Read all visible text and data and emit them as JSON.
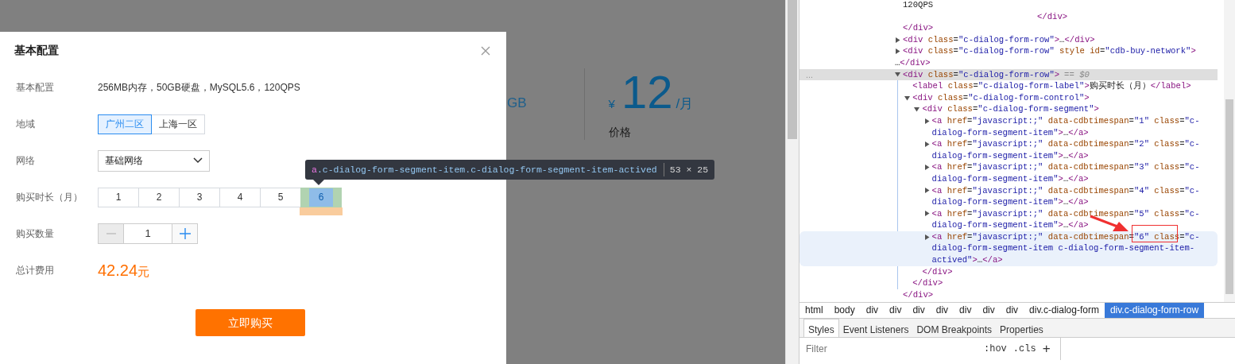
{
  "background_page": {
    "storage_unit": "GB",
    "price": {
      "currency": "¥",
      "amount": "12",
      "per": "/月",
      "label": "价格"
    }
  },
  "dialog": {
    "title": "基本配置",
    "rows": [
      {
        "kind": "text",
        "label": "基本配置",
        "value": "256MB内存，50GB硬盘，MySQL5.6，120QPS"
      },
      {
        "kind": "segmented",
        "label": "地域",
        "options": [
          {
            "label": "广州二区",
            "selected": true,
            "inspected": false
          },
          {
            "label": "上海一区",
            "selected": false,
            "inspected": false
          }
        ]
      },
      {
        "kind": "select",
        "label": "网络",
        "value": "基础网络"
      },
      {
        "kind": "segmented",
        "label": "购买时长（月）",
        "options": [
          {
            "label": "1",
            "selected": false,
            "inspected": false
          },
          {
            "label": "2",
            "selected": false,
            "inspected": false
          },
          {
            "label": "3",
            "selected": false,
            "inspected": false
          },
          {
            "label": "4",
            "selected": false,
            "inspected": false
          },
          {
            "label": "5",
            "selected": false,
            "inspected": false
          },
          {
            "label": "6",
            "selected": true,
            "inspected": true
          }
        ]
      },
      {
        "kind": "stepper",
        "label": "购买数量",
        "value": "1",
        "decrement_disabled": true
      },
      {
        "kind": "total",
        "label": "总计费用",
        "amount": "42.24",
        "unit": "元"
      }
    ],
    "button": "立即购买"
  },
  "inspect_tooltip": {
    "tag": "a",
    "selector": ".c-dialog-form-segment-item.c-dialog-form-segment-item-actived",
    "size": "53 × 25"
  },
  "devtools": {
    "dom_tree": [
      {
        "kind": "text",
        "markup": "120QPS"
      },
      {
        "kind": "tail",
        "markup": "</div>"
      },
      {
        "kind": "closing",
        "markup": "</div>"
      },
      {
        "kind": "element",
        "markup": "<div class=\"c-dialog-form-row\">…</div>",
        "expanded": false,
        "selected": false,
        "hovered": false
      },
      {
        "kind": "element",
        "markup": "<div class=\"c-dialog-form-row\" style id=\"cdb-buy-network\">",
        "wrapped_tail": "…</div>",
        "expanded": false,
        "selected": false,
        "hovered": false
      },
      {
        "kind": "element",
        "markup": "<div class=\"c-dialog-form-row\">",
        "expanded": true,
        "selected": true,
        "hovered": false,
        "gutter": "...",
        "console_ref": "== $0",
        "closing": "</div>",
        "children": [
          {
            "kind": "element",
            "markup": "<label class=\"c-dialog-form-label\">购买时长（月）</label>",
            "selected": false,
            "hovered": false
          },
          {
            "kind": "element",
            "markup": "<div class=\"c-dialog-form-control\">",
            "expanded": true,
            "selected": false,
            "hovered": false,
            "closing": "</div>",
            "children": [
              {
                "kind": "element",
                "markup": "<div class=\"c-dialog-form-segment\">",
                "expanded": true,
                "selected": false,
                "hovered": false,
                "closing": "</div>",
                "children": [
                  {
                    "kind": "element",
                    "markup": "<a href=\"javascript:;\" data-cdbtimespan=\"1\" class=\"c-dialog-form-segment-item\">…</a>",
                    "expanded": false,
                    "selected": false,
                    "hovered": false
                  },
                  {
                    "kind": "element",
                    "markup": "<a href=\"javascript:;\" data-cdbtimespan=\"2\" class=\"c-dialog-form-segment-item\">…</a>",
                    "expanded": false,
                    "selected": false,
                    "hovered": false
                  },
                  {
                    "kind": "element",
                    "markup": "<a href=\"javascript:;\" data-cdbtimespan=\"3\" class=\"c-dialog-form-segment-item\">…</a>",
                    "expanded": false,
                    "selected": false,
                    "hovered": false
                  },
                  {
                    "kind": "element",
                    "markup": "<a href=\"javascript:;\" data-cdbtimespan=\"4\" class=\"c-dialog-form-segment-item\">…</a>",
                    "expanded": false,
                    "selected": false,
                    "hovered": false
                  },
                  {
                    "kind": "element",
                    "markup": "<a href=\"javascript:;\" data-cdbtimespan=\"5\" class=\"c-dialog-form-segment-item\">…</a>",
                    "expanded": false,
                    "selected": false,
                    "hovered": false
                  },
                  {
                    "kind": "element",
                    "markup": "<a href=\"javascript:;\" data-cdbtimespan=\"6\" class=\"c-dialog-form-segment-item c-dialog-form-segment-item-actived\">…</a>",
                    "expanded": false,
                    "selected": false,
                    "hovered": true
                  }
                ]
              }
            ]
          }
        ]
      }
    ],
    "breadcrumbs": [
      {
        "label": "html",
        "selected": false
      },
      {
        "label": "body",
        "selected": false
      },
      {
        "label": "div",
        "selected": false
      },
      {
        "label": "div",
        "selected": false
      },
      {
        "label": "div",
        "selected": false
      },
      {
        "label": "div",
        "selected": false
      },
      {
        "label": "div",
        "selected": false
      },
      {
        "label": "div",
        "selected": false
      },
      {
        "label": "div",
        "selected": false
      },
      {
        "label": "div.c-dialog-form",
        "selected": false
      },
      {
        "label": "div.c-dialog-form-row",
        "selected": true
      }
    ],
    "tabs": [
      {
        "label": "Styles",
        "selected": true
      },
      {
        "label": "Event Listeners",
        "selected": false
      },
      {
        "label": "DOM Breakpoints",
        "selected": false
      },
      {
        "label": "Properties",
        "selected": false
      }
    ],
    "filter": {
      "placeholder": "Filter"
    },
    "filter_buttons": [
      ":hov",
      ".cls",
      "+"
    ]
  }
}
